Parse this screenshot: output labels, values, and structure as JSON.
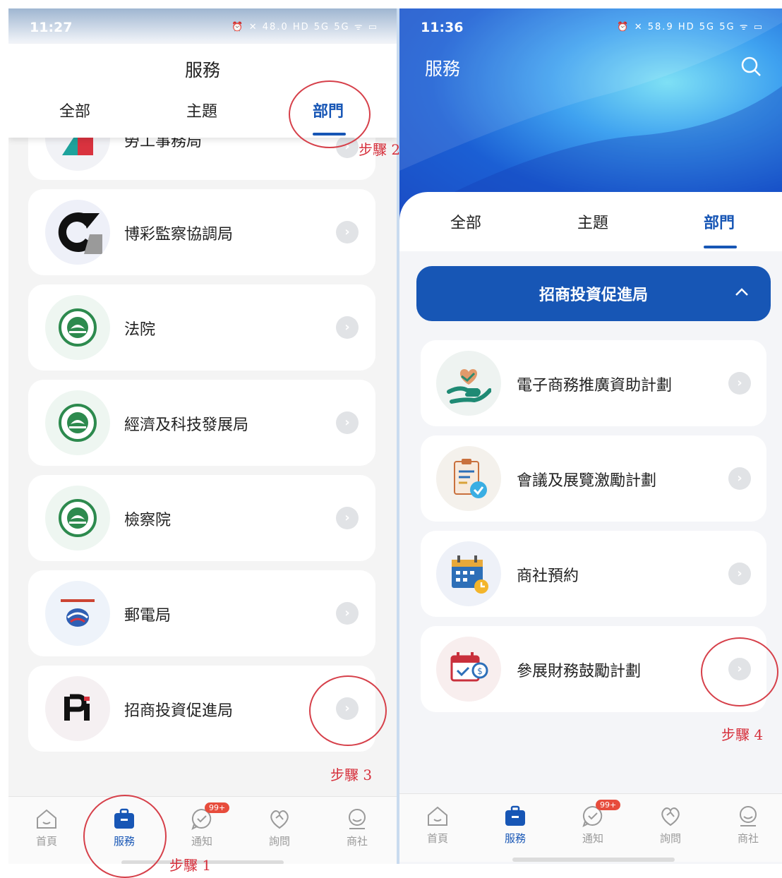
{
  "left": {
    "status_time": "11:27",
    "status_icons": "⏰ ✕ 48.0 HD 5G 5G ᯤ ▭",
    "title": "服務",
    "tabs": [
      "全部",
      "主題",
      "部門"
    ],
    "partial_item": "勞工事務局",
    "items": [
      "博彩監察協調局",
      "法院",
      "經濟及科技發展局",
      "檢察院",
      "郵電局",
      "招商投資促進局"
    ]
  },
  "right": {
    "status_time": "11:36",
    "status_icons": "⏰ ✕ 58.9 HD 5G 5G ᯤ ▭",
    "title": "服務",
    "tabs": [
      "全部",
      "主題",
      "部門"
    ],
    "department": "招商投資促進局",
    "items": [
      "電子商務推廣資助計劃",
      "會議及展覽激勵計劃",
      "商社預約",
      "參展財務鼓勵計劃"
    ]
  },
  "nav": {
    "items": [
      "首頁",
      "服務",
      "通知",
      "詢問",
      "商社"
    ],
    "badge": "99+"
  },
  "annotations": [
    "步驟 1",
    "步驟 2",
    "步驟 3",
    "步驟 4"
  ],
  "colors": {
    "accent": "#1756b5",
    "annotation": "#d6404a"
  }
}
